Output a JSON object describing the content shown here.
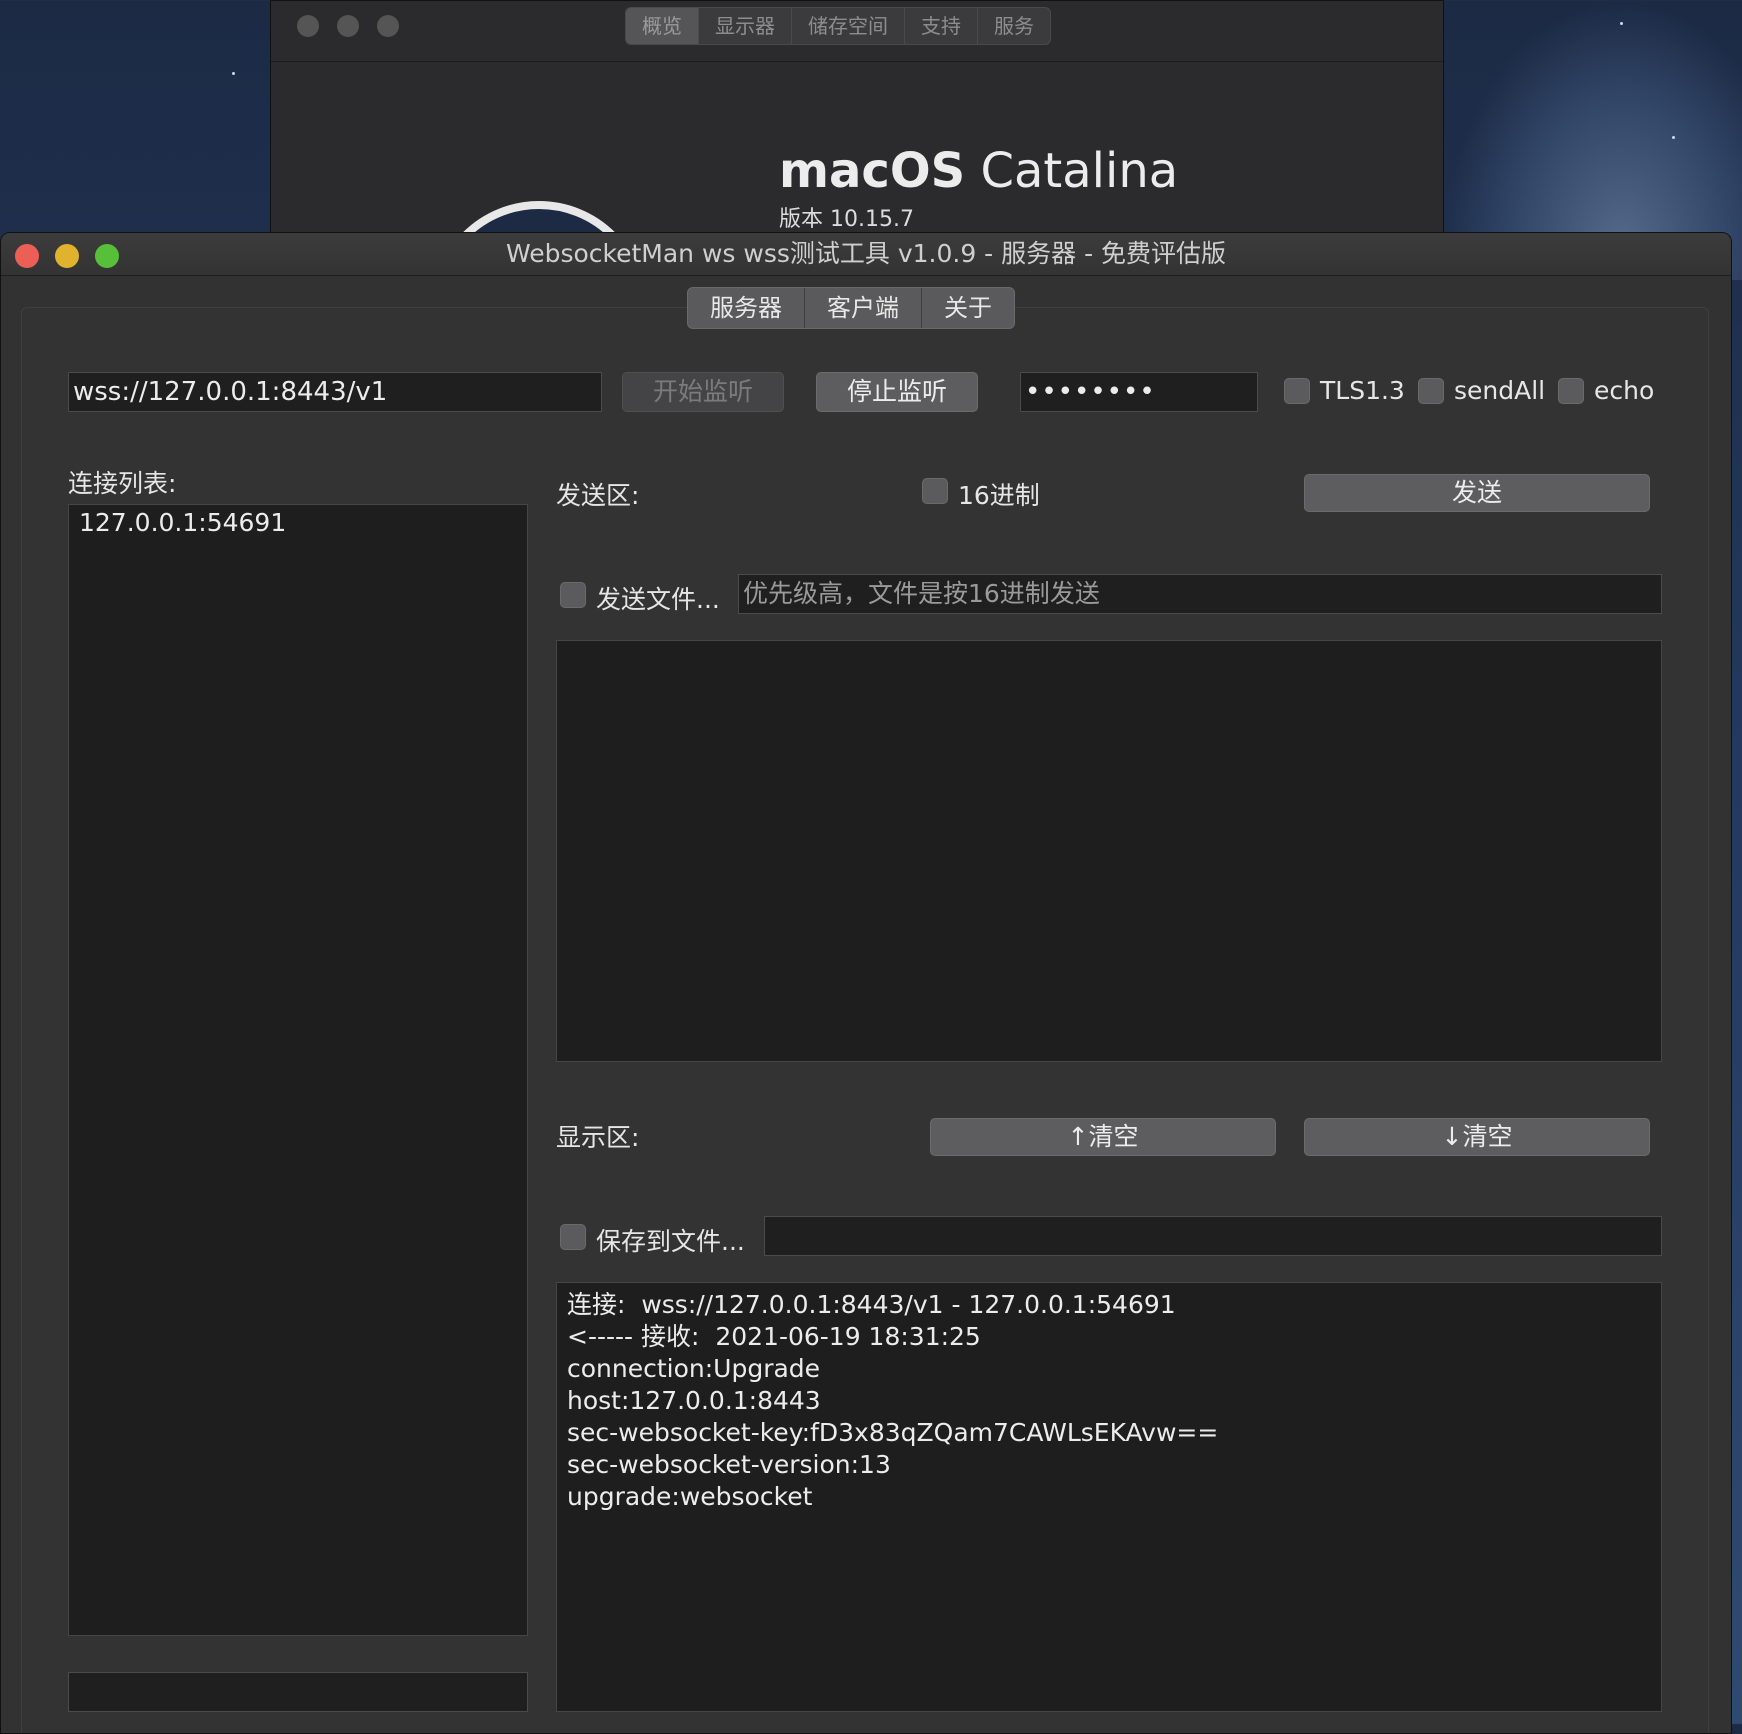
{
  "about_window": {
    "tabs": [
      "概览",
      "显示器",
      "储存空间",
      "支持",
      "服务"
    ],
    "title_bold": "macOS",
    "title_light": "Catalina",
    "version": "版本 10.15.7"
  },
  "app": {
    "window_title": "WebsocketMan ws wss测试工具 v1.0.9  - 服务器 - 免费评估版",
    "tabs": [
      "服务器",
      "客户端",
      "关于"
    ],
    "toolbar": {
      "url_value": "wss://127.0.0.1:8443/v1",
      "start_label": "开始监听",
      "stop_label": "停止监听",
      "password_value": "••••••••",
      "tls_label": "TLS1.3",
      "sendall_label": "sendAll",
      "echo_label": "echo"
    },
    "connections": {
      "title": "连接列表:",
      "items": [
        "127.0.0.1:54691"
      ]
    },
    "send": {
      "title": "发送区:",
      "hex_label": "16进制",
      "send_button": "发送",
      "send_file_label": "发送文件...",
      "send_file_placeholder": "优先级高，文件是按16进制发送"
    },
    "display": {
      "title": "显示区:",
      "clear_up": "↑清空",
      "clear_down": "↓清空",
      "save_file_label": "保存到文件...",
      "log": [
        "连接:  wss://127.0.0.1:8443/v1 - 127.0.0.1:54691",
        "",
        "",
        "<----- 接收:  2021-06-19 18:31:25",
        "connection:Upgrade",
        "host:127.0.0.1:8443",
        "sec-websocket-key:fD3x83qZQam7CAWLsEKAvw==",
        "sec-websocket-version:13",
        "upgrade:websocket"
      ]
    }
  },
  "colors": {
    "close": "#ec5f57",
    "minimize": "#e0b22e",
    "zoom": "#57c038"
  }
}
